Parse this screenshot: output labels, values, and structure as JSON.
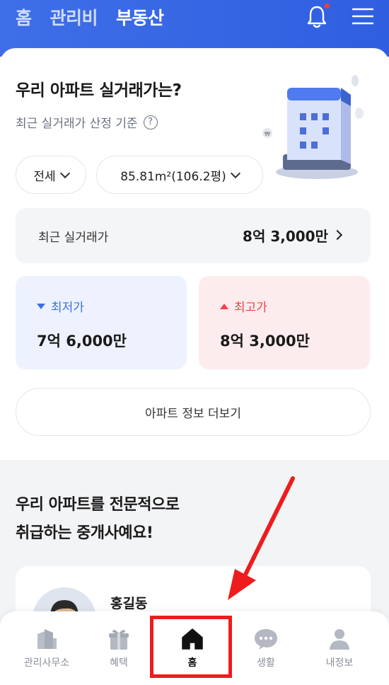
{
  "header": {
    "tabs": [
      {
        "label": "홈"
      },
      {
        "label": "관리비"
      },
      {
        "label": "부동산"
      }
    ],
    "active_tab": "부동산",
    "icons": [
      "bell-icon",
      "menu-icon"
    ],
    "notification_dot_color": "#ff3b30"
  },
  "price_card": {
    "title": "우리 아파트 실거래가는?",
    "subtitle": "최근 실거래가 산정 기준",
    "help_glyph": "?",
    "filters": {
      "type": "전세",
      "area": "85.81m²(106.2평)"
    },
    "recent": {
      "label": "최근 실거래가",
      "value": "8억 3,000만"
    },
    "lowest": {
      "label": "최저가",
      "value": "7억 6,000만"
    },
    "highest": {
      "label": "최고가",
      "value": "8억 3,000만"
    },
    "more_button": "아파트 정보 더보기"
  },
  "agents_section": {
    "title_line1": "우리 아파트를 전문적으로",
    "title_line2": "취급하는 중개사예요!",
    "agent_name": "홍길동"
  },
  "bottom_nav": {
    "items": [
      {
        "label": "관리사무소",
        "icon": "building-icon"
      },
      {
        "label": "혜택",
        "icon": "gift-icon"
      },
      {
        "label": "홈",
        "icon": "home-icon"
      },
      {
        "label": "생활",
        "icon": "chat-icon"
      },
      {
        "label": "내정보",
        "icon": "person-icon"
      }
    ],
    "active": "홈"
  },
  "colors": {
    "header_blue": "#3566e6",
    "low_blue": "#3b6fe6",
    "high_red": "#ef4444",
    "annotation_red": "#ee1c1c"
  }
}
